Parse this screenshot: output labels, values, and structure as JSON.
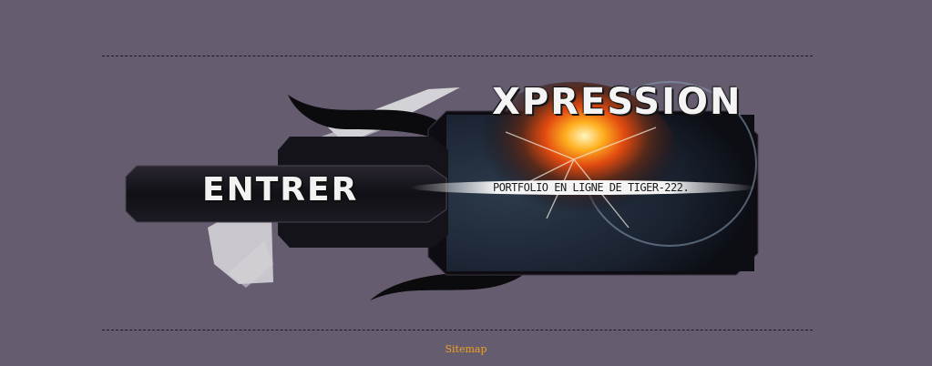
{
  "banner": {
    "title": "XPRESSION",
    "enter_label": "ENTRER",
    "tagline": "PORTFOLIO EN LIGNE DE TIGER-222."
  },
  "footer": {
    "sitemap_label": "Sitemap"
  },
  "colors": {
    "background": "#655c70",
    "link": "#f0a020",
    "panel": "#0e0c12"
  }
}
